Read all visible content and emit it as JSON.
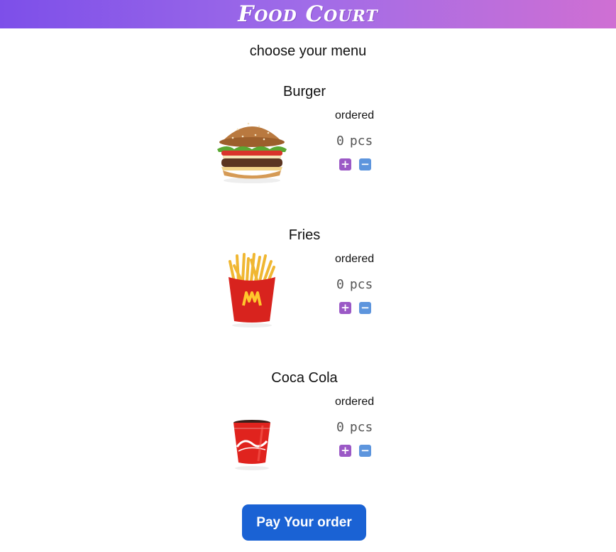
{
  "header": {
    "title": "Food Court"
  },
  "page": {
    "subtitle": "choose your menu"
  },
  "menu": {
    "items": [
      {
        "name": "Burger",
        "ordered_label": "ordered",
        "quantity": "0",
        "unit": "pcs",
        "plus": "+",
        "minus": "−"
      },
      {
        "name": "Fries",
        "ordered_label": "ordered",
        "quantity": "0",
        "unit": "pcs",
        "plus": "+",
        "minus": "−"
      },
      {
        "name": "Coca Cola",
        "ordered_label": "ordered",
        "quantity": "0",
        "unit": "pcs",
        "plus": "+",
        "minus": "−"
      }
    ]
  },
  "footer": {
    "pay_label": "Pay Your order"
  },
  "colors": {
    "header_start": "#7d4fe9",
    "header_end": "#cf6fd3",
    "plus": "#9b59c6",
    "minus": "#5d95dd",
    "pay": "#1a62d4"
  }
}
